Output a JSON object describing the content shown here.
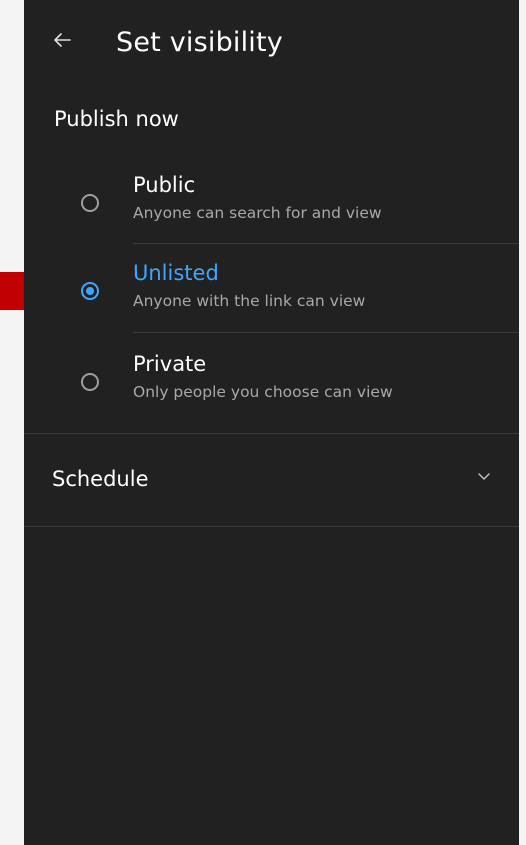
{
  "header": {
    "title": "Set visibility",
    "back_icon": "arrow-left-icon"
  },
  "publish_now": {
    "label": "Publish now",
    "options": [
      {
        "title": "Public",
        "subtitle": "Anyone can search for and view",
        "selected": false
      },
      {
        "title": "Unlisted",
        "subtitle": "Anyone with the link can view",
        "selected": true
      },
      {
        "title": "Private",
        "subtitle": "Only people you choose can view",
        "selected": false
      }
    ]
  },
  "schedule": {
    "label": "Schedule",
    "expand_icon": "chevron-down-icon"
  },
  "colors": {
    "background": "#212121",
    "accent": "#3ea6ff",
    "annotation_arrow": "#c00000"
  }
}
